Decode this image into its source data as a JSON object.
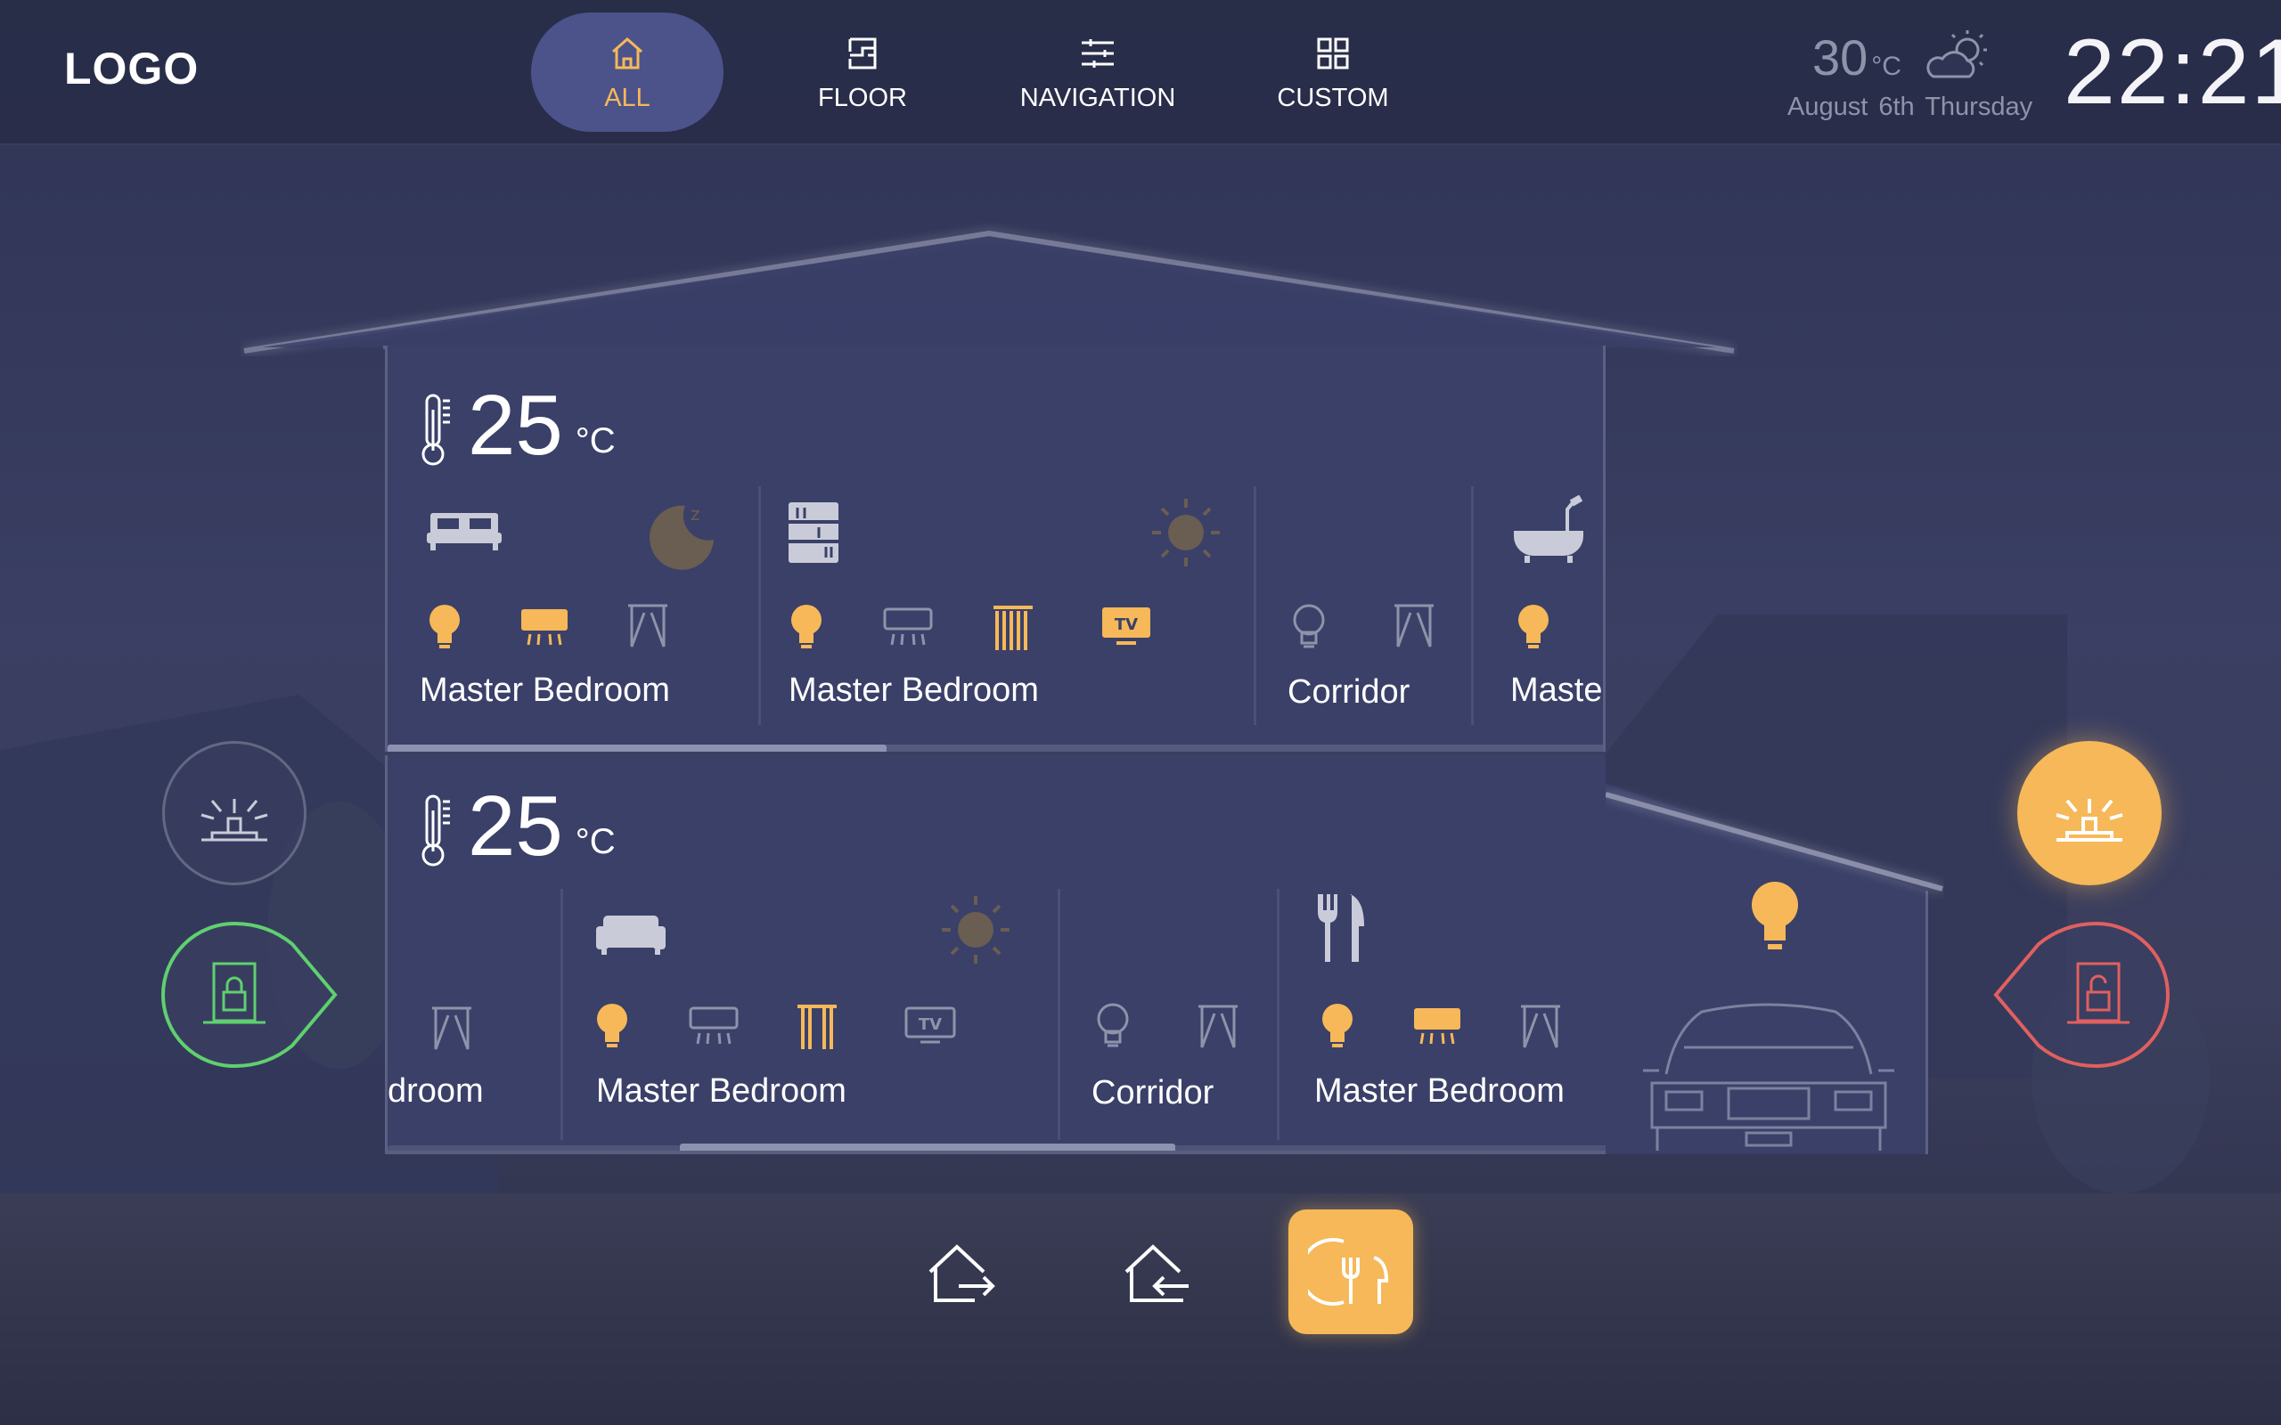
{
  "logo": "LOGO",
  "tabs": [
    {
      "label": "ALL",
      "icon": "home-icon",
      "active": true
    },
    {
      "label": "FLOOR",
      "icon": "floorplan-icon",
      "active": false
    },
    {
      "label": "NAVIGATION",
      "icon": "sliders-icon",
      "active": false
    },
    {
      "label": "CUSTOM",
      "icon": "grid-icon",
      "active": false
    }
  ],
  "weather": {
    "temperature": "30",
    "unit": "°C",
    "date": "August 6th Thursday",
    "icon": "partly-cloudy-icon"
  },
  "clock": "22:21",
  "colors": {
    "accent": "#f6b858",
    "panel": "#3a4068",
    "lock_open": "#e0605f",
    "lock_closed": "#5fd06f"
  },
  "floors": [
    {
      "temperature": "25",
      "unit": "°C",
      "rooms": [
        {
          "name": "Master Bedroom",
          "scene": "bed-icon",
          "mode": "sleep-moon-icon"
        },
        {
          "name": "Master Bedroom",
          "scene": "bookshelf-icon",
          "mode": "sun-icon"
        },
        {
          "name": "Corridor"
        },
        {
          "name": "Maste",
          "scene": "bathtub-icon"
        }
      ]
    },
    {
      "temperature": "25",
      "unit": "°C",
      "rooms": [
        {
          "name": "droom"
        },
        {
          "name": "Master Bedroom",
          "scene": "sofa-icon",
          "mode": "sun-icon"
        },
        {
          "name": "Corridor"
        },
        {
          "name": "Master Bedroom",
          "scene": "dining-icon"
        }
      ]
    }
  ],
  "garage": {
    "icons": [
      "light-bulb-icon",
      "car-icon"
    ]
  },
  "side_controls": [
    "sprinkler-icon",
    "lock-icon",
    "sprinkler-icon",
    "unlock-icon"
  ],
  "actions": [
    {
      "icon": "leave-home-icon",
      "active": false
    },
    {
      "icon": "arrive-home-icon",
      "active": false
    },
    {
      "icon": "dining-scene-icon",
      "active": true
    }
  ]
}
